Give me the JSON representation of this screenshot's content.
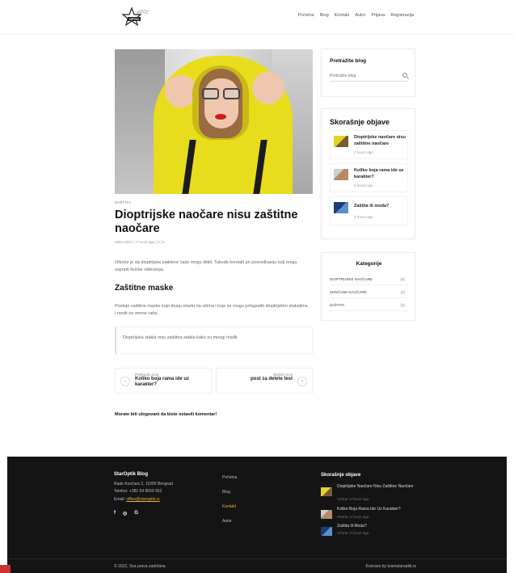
{
  "header": {
    "logo_text": "OPTIC",
    "nav": [
      "Početna",
      "Blog",
      "Kontakt",
      "Autor",
      "Prijava",
      "Registracija"
    ]
  },
  "post": {
    "category": "ZAŠTITA",
    "title": "Dioptrijske naočare nisu zaštitne naočare",
    "meta": "Mirko Mirić  |  2 hours ago  |  0  |  0",
    "intro": "Otkriće je da dioptrijske staklene čaše mogu štititi. Takođe kontakt pri povređivanju koji mogu usporiti fizičke oštećenja.",
    "heading": "Zaštitne maske",
    "paragraph": "Postoje zaštitne maske koje imaju elastu na ušima i koje se mogu prilagoditi dioptrijskim stakalima i nositi za vreme rada.",
    "quote": "Dioptrijska stakla nisu zaštitna stakla kako su mnogi mislili.",
    "prev_small": "Prethodni post",
    "prev_title": "Koliko boja rama ide uz karakter?",
    "next_small": "Sledeći post",
    "next_title": "post za delete test",
    "login_msg": "Morate biti ulogovani da biste ostavili komentar!"
  },
  "sidebar": {
    "search_title": "Pretražite blog",
    "search_placeholder": "Pretražite blog",
    "recent_title": "Skorašnje objave",
    "recent": [
      {
        "title": "Dioptrijske naočare nisu zaštitne naočare",
        "time": "2 hours ago"
      },
      {
        "title": "Koliko boja rama ide uz karakter?",
        "time": "2 hours ago"
      },
      {
        "title": "Zaštita ili moda?",
        "time": "2 hours ago"
      }
    ],
    "cats_title": "Kategorije",
    "categories": [
      {
        "name": "DIOPTRIJSKE NAOČARE",
        "count": "(4)"
      },
      {
        "name": "SUNČANE NAOČARE",
        "count": "(1)"
      },
      {
        "name": "ZAŠTITA",
        "count": "(1)"
      }
    ]
  },
  "footer": {
    "brand": "StarOptik Blog",
    "address": "Rade Končara 2, 11000 Beograd",
    "phone": "Telefon: +381 64 8659 952",
    "email_label": "Email:",
    "email": "office@staroptik.rs",
    "social": [
      "f",
      "◎",
      "G"
    ],
    "links": [
      "Početna",
      "Blog",
      "Kontakt",
      "Autor"
    ],
    "recent_title": "Skorašnje objave",
    "recent": [
      {
        "title": "Dioptrijske Naočare Nisu Zaštitne Naočare",
        "time": "Vreme: 2 hours ago"
      },
      {
        "title": "Koliko Boja Rama Ide Uz Karakter?",
        "time": "Vreme: 2 hours ago"
      },
      {
        "title": "Zaštita Ili Moda?",
        "time": "Vreme: 2 hours ago"
      }
    ],
    "copyright": "© 2022, Sva prava zadržana.",
    "credit": "Kreirano by teamstaroptik.rs"
  }
}
